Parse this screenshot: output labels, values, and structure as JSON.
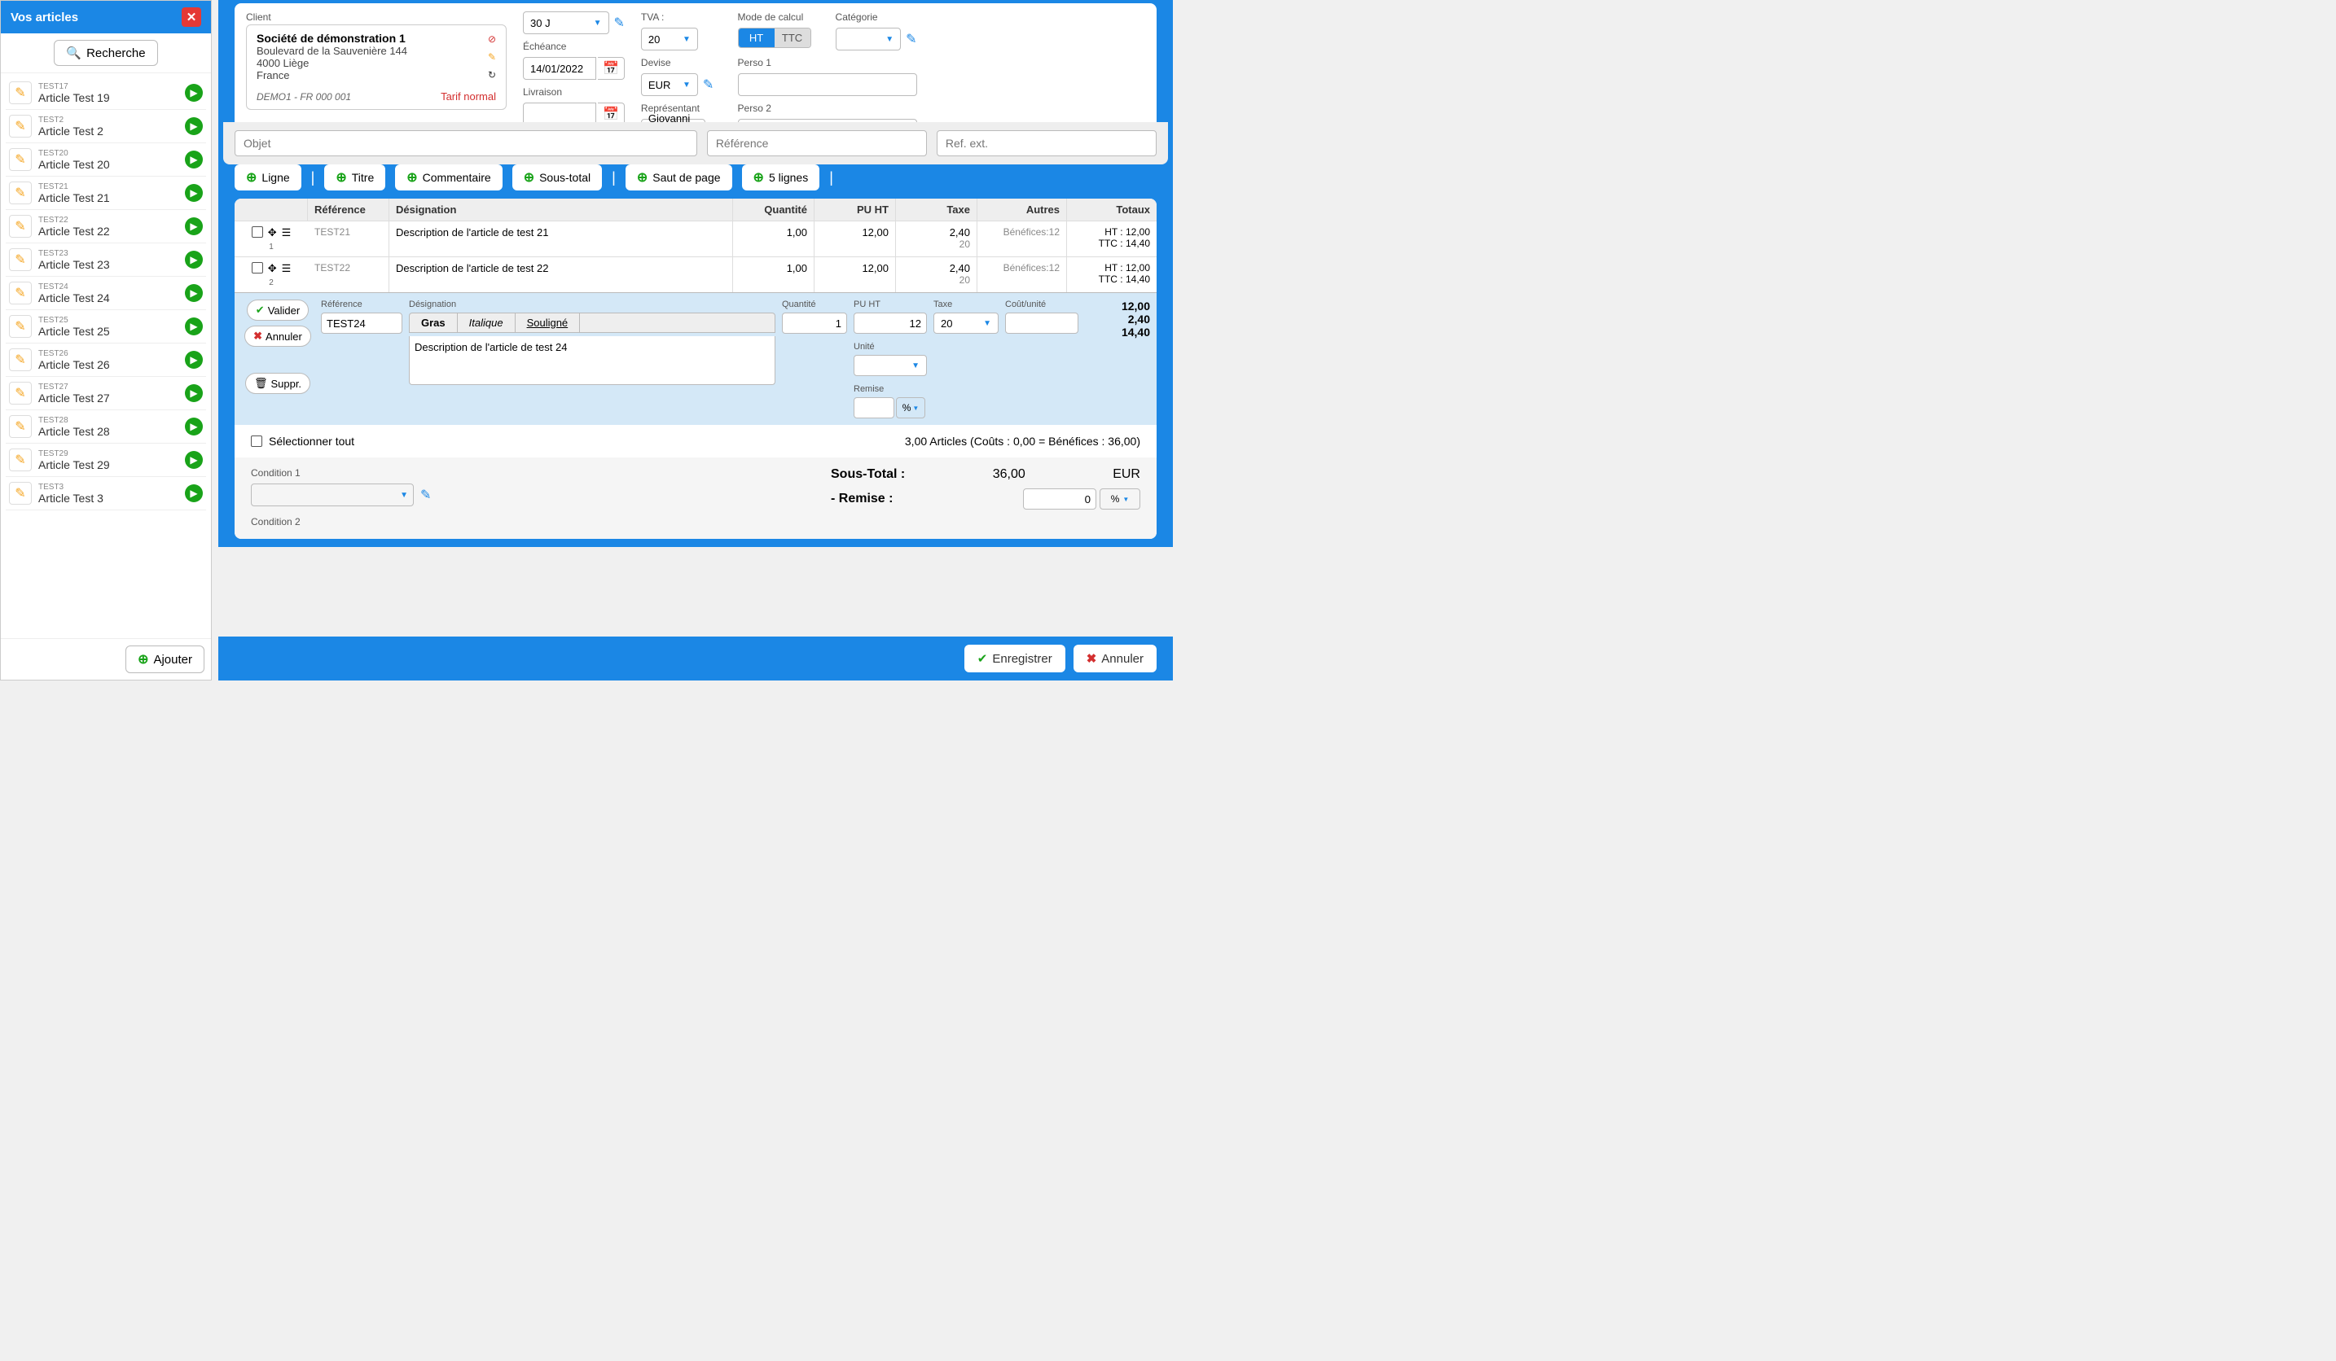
{
  "sidebar": {
    "title": "Vos articles",
    "search_label": "Recherche",
    "add_label": "Ajouter",
    "items": [
      {
        "code": "TEST17",
        "name": "Article Test 19"
      },
      {
        "code": "TEST2",
        "name": "Article Test 2"
      },
      {
        "code": "TEST20",
        "name": "Article Test 20"
      },
      {
        "code": "TEST21",
        "name": "Article Test 21"
      },
      {
        "code": "TEST22",
        "name": "Article Test 22"
      },
      {
        "code": "TEST23",
        "name": "Article Test 23"
      },
      {
        "code": "TEST24",
        "name": "Article Test 24"
      },
      {
        "code": "TEST25",
        "name": "Article Test 25"
      },
      {
        "code": "TEST26",
        "name": "Article Test 26"
      },
      {
        "code": "TEST27",
        "name": "Article Test 27"
      },
      {
        "code": "TEST28",
        "name": "Article Test 28"
      },
      {
        "code": "TEST29",
        "name": "Article Test 29"
      },
      {
        "code": "TEST3",
        "name": "Article Test 3"
      }
    ]
  },
  "header": {
    "client_label": "Client",
    "client_name": "Société de démonstration 1",
    "client_addr1": "Boulevard de la Sauvenière 144",
    "client_addr2": "4000 Liège",
    "client_country": "France",
    "client_code": "DEMO1 - FR 000 001",
    "tarif": "Tarif normal",
    "terms_value": "30 J",
    "echeance_label": "Échéance",
    "echeance_value": "14/01/2022",
    "livraison_label": "Livraison",
    "tva_label": "TVA :",
    "tva_value": "20",
    "devise_label": "Devise",
    "devise_value": "EUR",
    "representant_label": "Représentant",
    "representant_value": "Giovanni La Mantia",
    "mode_label": "Mode de calcul",
    "ht_label": "HT",
    "ttc_label": "TTC",
    "categorie_label": "Catégorie",
    "perso1_label": "Perso 1",
    "perso2_label": "Perso 2",
    "objet_ph": "Objet",
    "reference_ph": "Référence",
    "refext_ph": "Ref. ext."
  },
  "toolbar": {
    "ligne": "Ligne",
    "titre": "Titre",
    "commentaire": "Commentaire",
    "soustotal": "Sous-total",
    "saut": "Saut de page",
    "cinq": "5 lignes"
  },
  "table": {
    "h_ref": "Référence",
    "h_desig": "Désignation",
    "h_qty": "Quantité",
    "h_pu": "PU HT",
    "h_taxe": "Taxe",
    "h_autres": "Autres",
    "h_totaux": "Totaux",
    "rows": [
      {
        "num": "1",
        "ref": "TEST21",
        "desig": "Description de l'article de test 21",
        "qty": "1,00",
        "pu": "12,00",
        "taxe": "2,40",
        "taxe2": "20",
        "autres": "Bénéfices:12",
        "tot_ht": "HT : 12,00",
        "tot_ttc": "TTC : 14,40"
      },
      {
        "num": "2",
        "ref": "TEST22",
        "desig": "Description de l'article de test 22",
        "qty": "1,00",
        "pu": "12,00",
        "taxe": "2,40",
        "taxe2": "20",
        "autres": "Bénéfices:12",
        "tot_ht": "HT : 12,00",
        "tot_ttc": "TTC : 14,40"
      }
    ]
  },
  "edit": {
    "valider": "Valider",
    "annuler": "Annuler",
    "suppr": "Suppr.",
    "ref_label": "Référence",
    "ref_value": "TEST24",
    "desig_label": "Désignation",
    "gras": "Gras",
    "italique": "Italique",
    "souligne": "Souligné",
    "desig_value": "Description de l'article de test 24",
    "qty_label": "Quantité",
    "qty_value": "1",
    "pu_label": "PU HT",
    "pu_value": "12",
    "unite_label": "Unité",
    "remise_label": "Remise",
    "pct": "%",
    "taxe_label": "Taxe",
    "taxe_value": "20",
    "cout_label": "Coût/unité",
    "t1": "12,00",
    "t2": "2,40",
    "t3": "14,40"
  },
  "summary": {
    "select_all": "Sélectionner tout",
    "text": "3,00 Articles (Coûts : 0,00 = Bénéfices : 36,00)"
  },
  "conditions": {
    "c1": "Condition 1",
    "c2": "Condition 2",
    "subtotal_label": "Sous-Total :",
    "subtotal_value": "36,00",
    "subtotal_cur": "EUR",
    "remise_label": "- Remise :",
    "remise_value": "0",
    "remise_unit": "%"
  },
  "footer": {
    "save": "Enregistrer",
    "cancel": "Annuler"
  }
}
